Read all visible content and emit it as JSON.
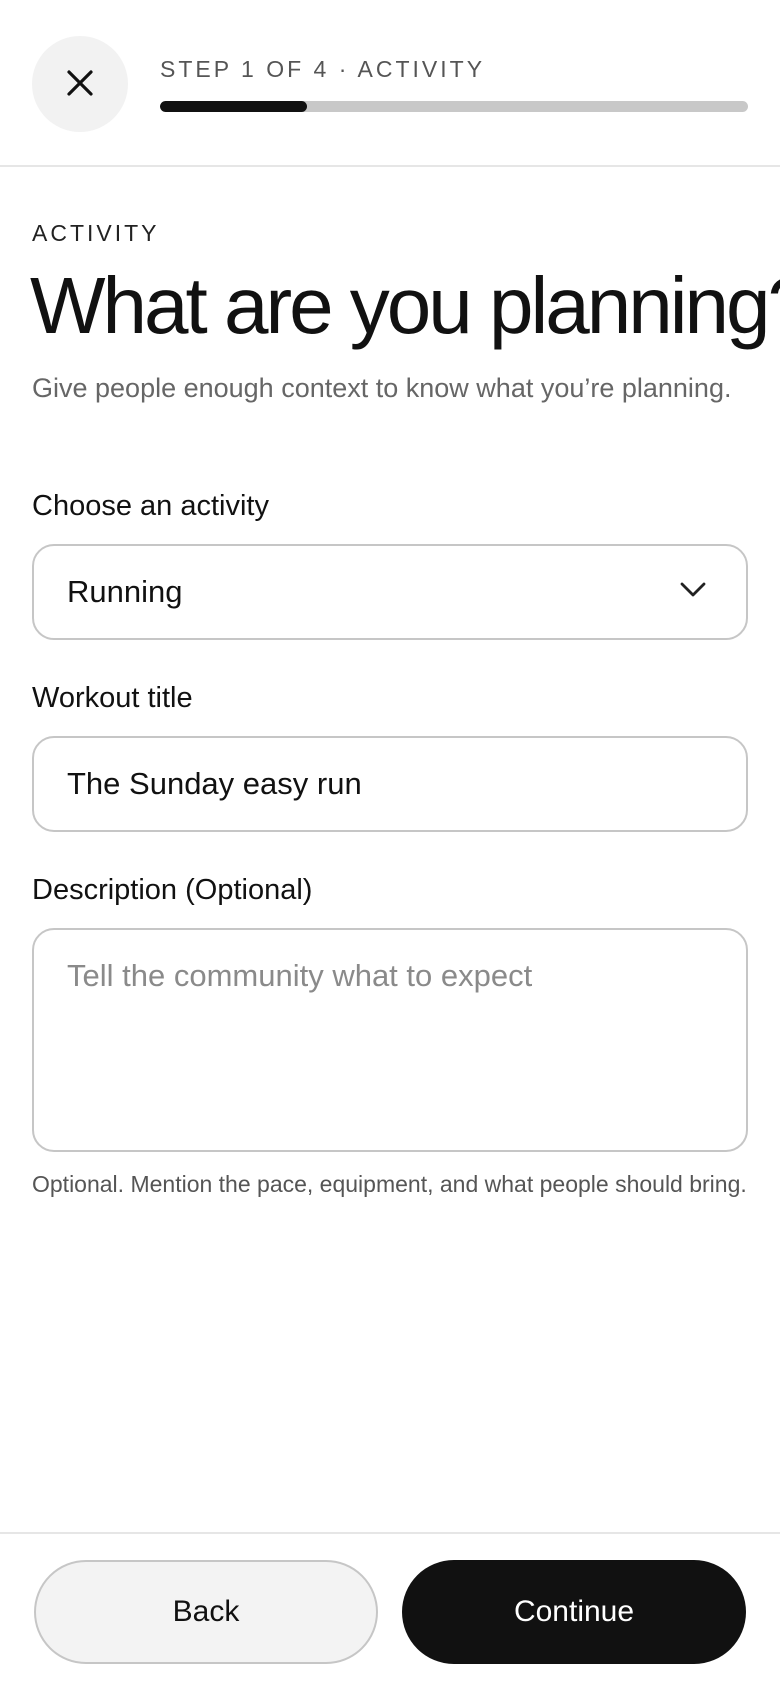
{
  "header": {
    "close_icon": "close-icon",
    "step_label": "STEP 1 OF 4 · ACTIVITY",
    "progress_fraction": 0.25
  },
  "main": {
    "eyebrow": "ACTIVITY",
    "title": "What are you planning?",
    "subtitle": "Give people enough context to know what you’re planning.",
    "activity": {
      "label": "Choose an activity",
      "selected": "Running",
      "icon": "chevron-down-icon"
    },
    "workout_title": {
      "label": "Workout title",
      "value": "The Sunday easy run"
    },
    "description": {
      "label": "Description (Optional)",
      "value": "",
      "placeholder": "Tell the community what to expect",
      "helper": "Optional. Mention the pace, equipment, and what people should bring."
    }
  },
  "footer": {
    "back_label": "Back",
    "continue_label": "Continue"
  }
}
